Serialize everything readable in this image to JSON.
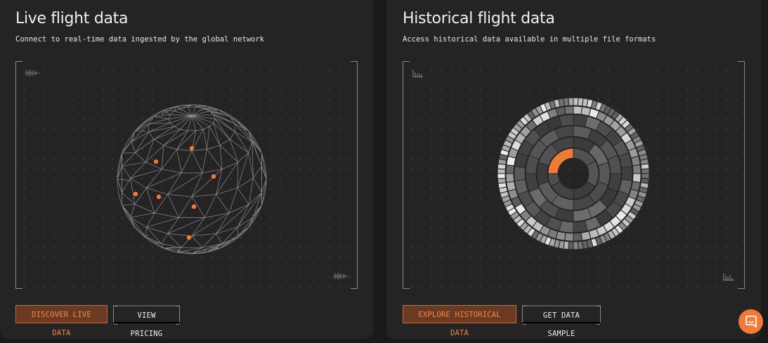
{
  "live": {
    "title": "Live flight data",
    "subtitle": "Connect to real-time data ingested by the global network",
    "primary_button": "DISCOVER LIVE DATA",
    "secondary_button": "VIEW PRICING"
  },
  "historical": {
    "title": "Historical flight data",
    "subtitle": "Access historical data available in multiple file formats",
    "primary_button": "EXPLORE HISTORICAL DATA",
    "secondary_button": "GET DATA SAMPLE"
  },
  "colors": {
    "accent": "#f07a3a",
    "background": "#1b1a1a",
    "card": "#252323"
  },
  "icons": {
    "globe": "wireframe-globe-icon",
    "sunburst": "sunburst-chart-icon",
    "chat": "chat-bubble-icon"
  }
}
